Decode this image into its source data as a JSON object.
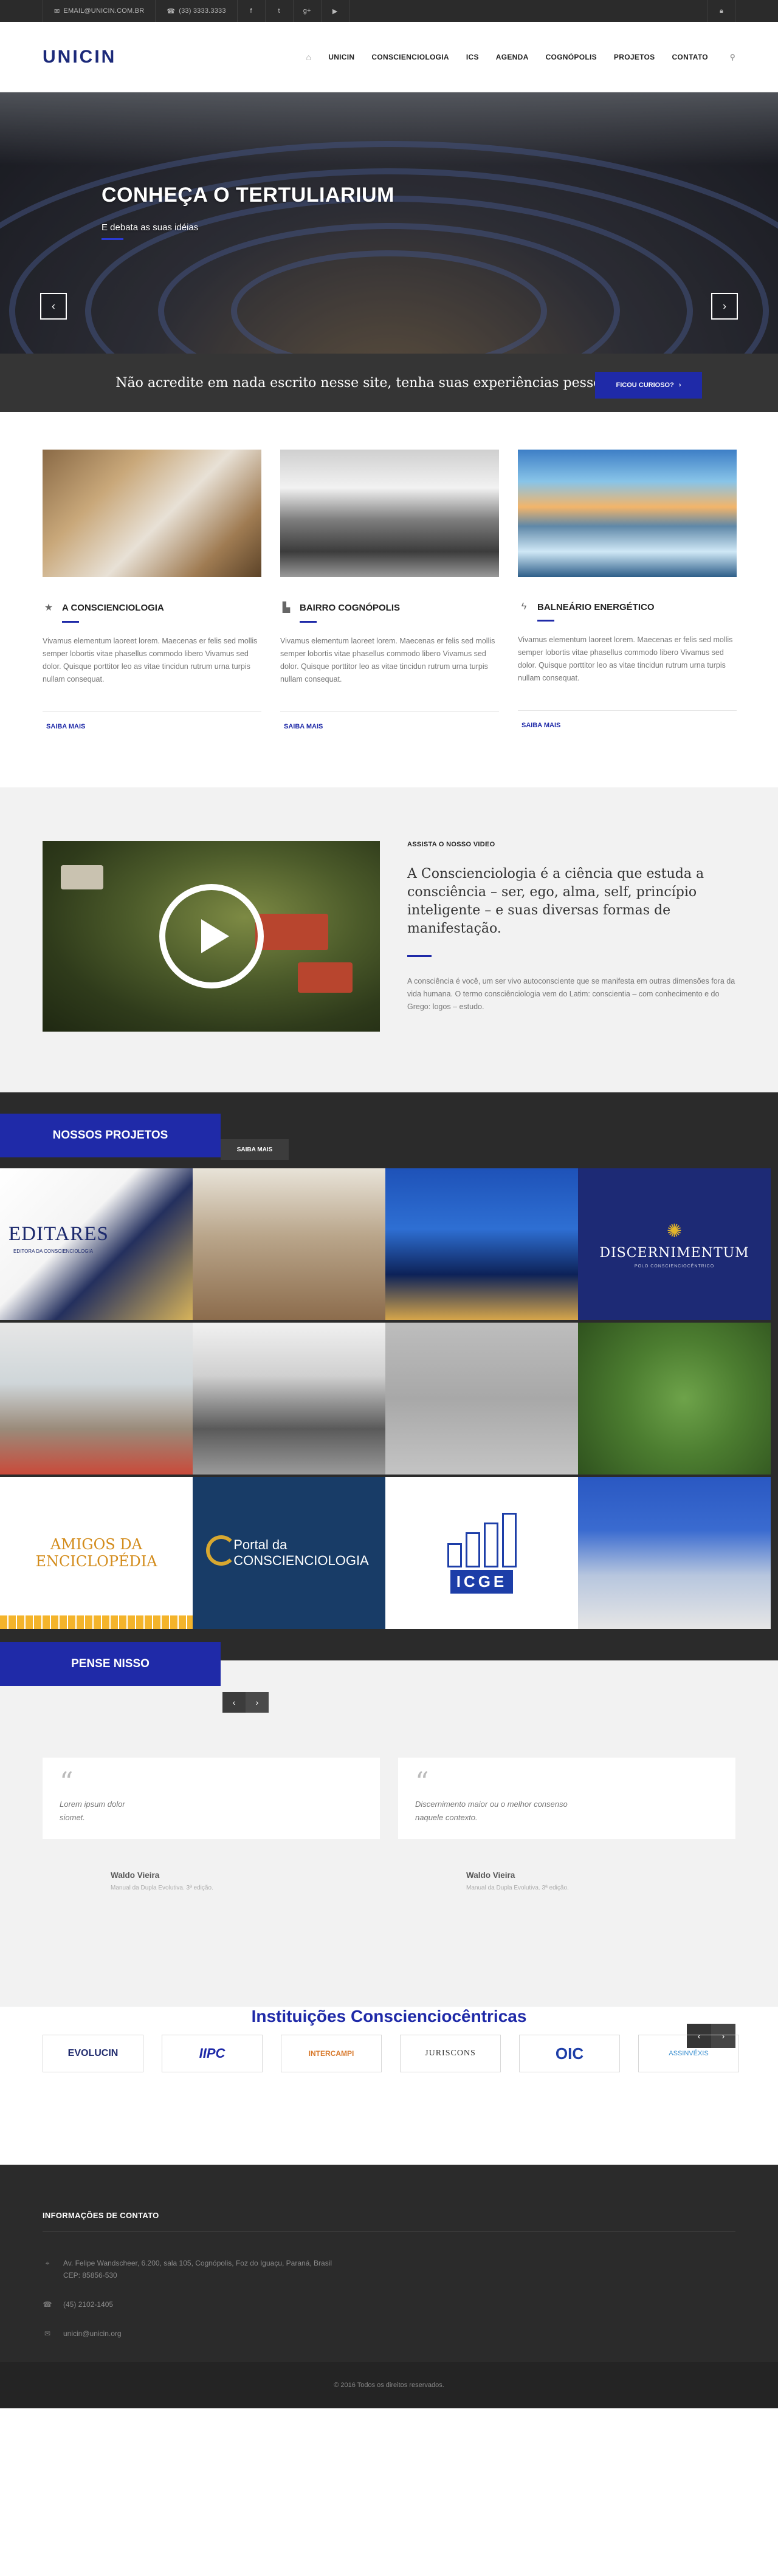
{
  "topbar": {
    "email": "EMAIL@UNICIN.COM.BR",
    "phone": "(33) 3333.3333",
    "socials": [
      {
        "icon": "facebook-icon",
        "glyph": "f"
      },
      {
        "icon": "twitter-icon",
        "glyph": "t"
      },
      {
        "icon": "google-plus-icon",
        "glyph": "g+"
      },
      {
        "icon": "youtube-icon",
        "glyph": "▶"
      }
    ]
  },
  "header": {
    "logo": "UNICIN",
    "nav": [
      "UNICIN",
      "CONSCIENCIOLOGIA",
      "ICS",
      "AGENDA",
      "COGNÓPOLIS",
      "PROJETOS",
      "CONTATO"
    ]
  },
  "hero": {
    "title": "CONHEÇA O TERTULIARIUM",
    "subtitle": "E debata as suas idéias"
  },
  "cta": {
    "text": "Não acredite em nada escrito nesse site, tenha suas experiências pessoais!",
    "button": "FICOU CURIOSO?"
  },
  "features": [
    {
      "icon": "star-icon",
      "title": "A CONSCIENCIOLOGIA",
      "text": "Vivamus elementum laoreet lorem. Maecenas er felis sed mollis semper lobortis vitae phasellus commodo libero Vivamus sed dolor. Quisque porttitor leo as vitae tincidun rutrum urna turpis nullam consequat.",
      "link": "SAIBA MAIS"
    },
    {
      "icon": "building-icon",
      "title": "BAIRRO COGNÓPOLIS",
      "text": "Vivamus elementum laoreet lorem. Maecenas er felis sed mollis semper lobortis vitae phasellus commodo libero Vivamus sed dolor. Quisque porttitor leo as vitae tincidun rutrum urna turpis nullam consequat.",
      "link": "SAIBA MAIS"
    },
    {
      "icon": "lightning-icon",
      "title": "BALNEÁRIO ENERGÉTICO",
      "text": "Vivamus elementum laoreet lorem. Maecenas er felis sed mollis semper lobortis vitae phasellus commodo libero Vivamus sed dolor. Quisque porttitor leo as vitae tincidun rutrum urna turpis nullam consequat.",
      "link": "SAIBA MAIS"
    }
  ],
  "video": {
    "eyebrow": "ASSISTA O NOSSO VIDEO",
    "title": "A Conscienciologia é a ciência que estuda a consciência – ser, ego, alma, self, princípio inteligente – e suas diversas formas de manifestação.",
    "text": "A consciência é você, um ser vivo autoconsciente que se manifesta em outras dimensões fora da vida humana. O termo consciênciologia vem do Latim: conscientia – com conhecimento e do Grego: logos – estudo."
  },
  "projects": {
    "title": "NOSSOS PROJETOS",
    "more": "SAIBA MAIS",
    "tiles": {
      "editares": "EDITARES",
      "editares_sub": "EDITORA DA CONSCIENCIOLOGIA",
      "discernimentum": "DISCERNIMENTUM",
      "discernimentum_sub": "POLO CONSCIENCIOCÊNTRICO",
      "amigos": "AMIGOS DA ENCICLOPÉDIA",
      "portal_line1": "Portal da",
      "portal_line2": "CONSCIENCIOLOGIA",
      "icge": "ICGE"
    }
  },
  "pense": {
    "title": "PENSE NISSO",
    "quotes": [
      {
        "text": "Lorem ipsum dolor siomet.",
        "author": "Waldo Vieira",
        "source": "Manual da Dupla Evolutiva. 3ª edição."
      },
      {
        "text": "Discernimento maior ou o melhor consenso naquele contexto.",
        "author": "Waldo Vieira",
        "source": "Manual da Dupla Evolutiva. 3ª edição."
      }
    ]
  },
  "institutions": {
    "title": "Instituições Conscienciocêntricas",
    "logos": [
      "EVOLUCIN",
      "IIPC",
      "INTERCAMPI",
      "JURISCONS",
      "OIC",
      "ASSINVÉXIS"
    ]
  },
  "footer": {
    "title": "INFORMAÇÕES DE CONTATO",
    "address": "Av. Felipe Wandscheer, 6.200, sala 105, Cognópolis, Foz do Iguaçu, Paraná, Brasil",
    "cep": "CEP: 85856-530",
    "phone": "(45) 2102-1405",
    "email": "unicin@unicin.org",
    "copyright": "© 2016 Todos os direitos reservados."
  }
}
